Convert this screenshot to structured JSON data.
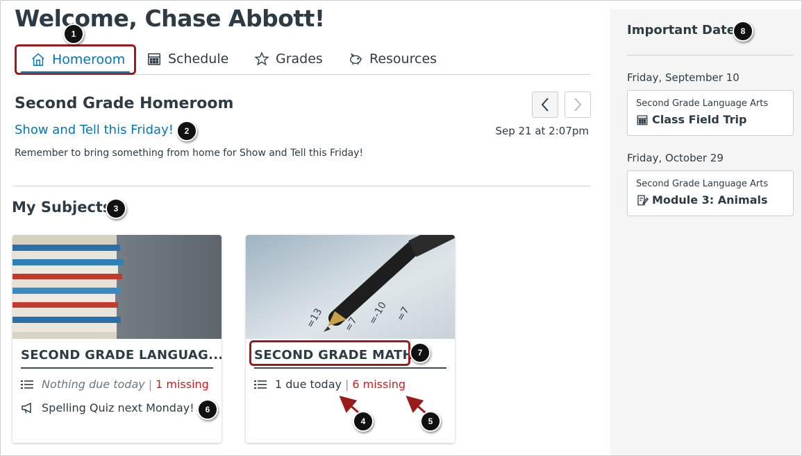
{
  "page": {
    "welcome": "Welcome, Chase Abbott!"
  },
  "tabs": [
    {
      "label": "Homeroom",
      "icon": "home-icon",
      "active": true
    },
    {
      "label": "Schedule",
      "icon": "calendar-icon"
    },
    {
      "label": "Grades",
      "icon": "star-icon"
    },
    {
      "label": "Resources",
      "icon": "piggy-bank-icon"
    }
  ],
  "homeroom": {
    "title": "Second Grade Homeroom",
    "announcement_title": "Show and Tell this Friday!",
    "announcement_date": "Sep 21 at 2:07pm",
    "announcement_body": "Remember to bring something from home for Show and Tell this Friday!"
  },
  "subjects": {
    "heading": "My Subjects",
    "cards": [
      {
        "title": "SECOND GRADE LANGUAG...",
        "due_text": "Nothing due today",
        "missing_text": "1 missing",
        "announcement": "Spelling Quiz next Monday!",
        "image": "stacked-books-photo"
      },
      {
        "title": "SECOND GRADE MATH",
        "due_text": "1 due today",
        "missing_text": "6 missing",
        "image": "pen-on-math-worksheet-photo"
      }
    ]
  },
  "important_dates": {
    "title": "Important Dates",
    "groups": [
      {
        "date": "Friday, September 10",
        "course": "Second Grade Language Arts",
        "item": "Class Field Trip",
        "icon": "calendar-icon"
      },
      {
        "date": "Friday, October 29",
        "course": "Second Grade Language Arts",
        "item": "Module 3: Animals",
        "icon": "assignment-icon"
      }
    ]
  },
  "callouts": [
    "1",
    "2",
    "3",
    "4",
    "5",
    "6",
    "7",
    "8"
  ],
  "colors": {
    "link": "#0374b5",
    "text": "#2d3b45",
    "missing": "#d01a19",
    "highlight": "#9b1b1b",
    "panel": "#f5f5f5"
  }
}
